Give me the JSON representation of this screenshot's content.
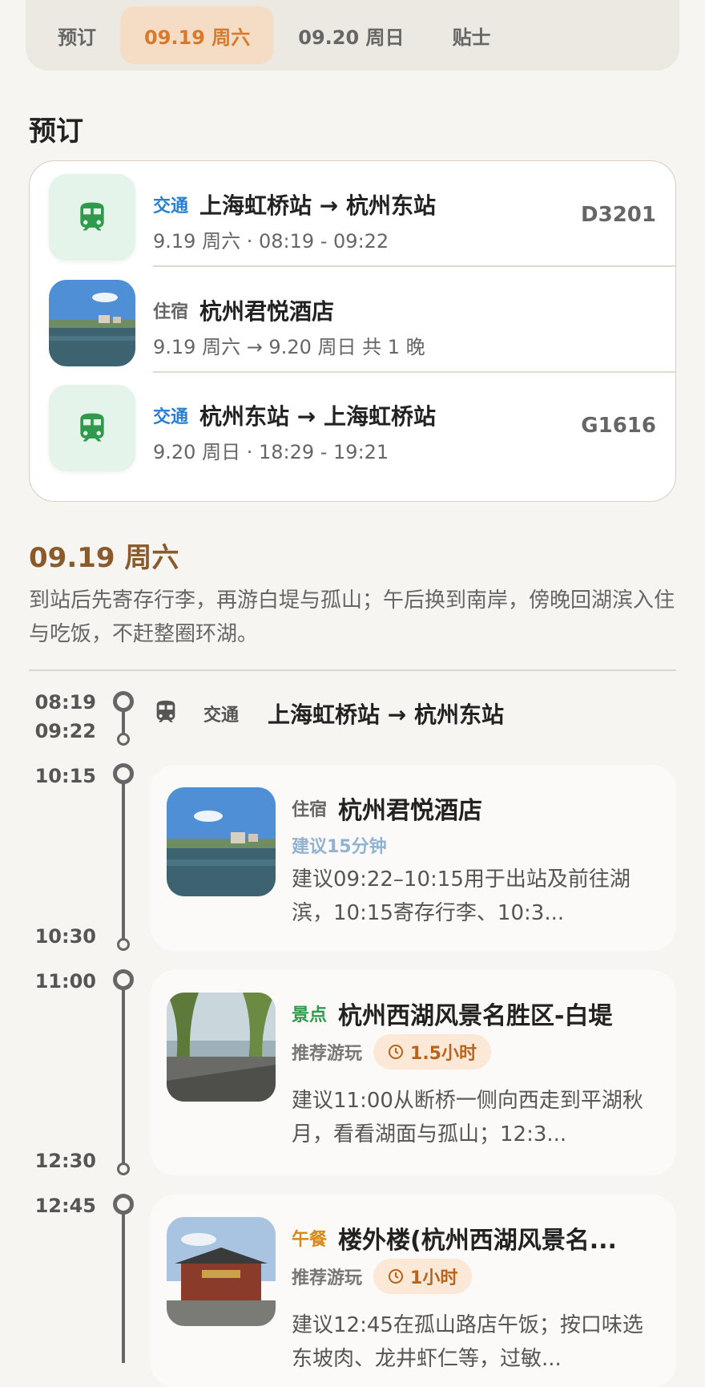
{
  "tabs": [
    "预订",
    "09.19 周六",
    "09.20 周日",
    "贴士"
  ],
  "booking_title": "预订",
  "bookings": [
    {
      "tag": "交通",
      "name": "上海虹桥站 → 杭州东站",
      "sub": "9.19 周六 · 08:19 - 09:22",
      "code": "D3201"
    },
    {
      "tag": "住宿",
      "name": "杭州君悦酒店",
      "sub": "9.19 周六 → 9.20 周日 共 1 晚"
    },
    {
      "tag": "交通",
      "name": "杭州东站 → 上海虹桥站",
      "sub": "9.20 周日 · 18:29 - 19:21",
      "code": "G1616"
    }
  ],
  "day": {
    "title": "09.19 周六",
    "desc": "到站后先寄存行李，再游白堤与孤山；午后换到南岸，傍晚回湖滨入住与吃饭，不赶整圈环湖。"
  },
  "timeline": {
    "transit": {
      "start": "08:19",
      "end": "09:22",
      "label": "交通",
      "route": "上海虹桥站 → 杭州东站"
    },
    "items": [
      {
        "start": "10:15",
        "end": "10:30",
        "tag": "住宿",
        "name": "杭州君悦酒店",
        "hint": "建议15分钟",
        "desc": "建议09:22–10:15用于出站及前往湖滨，10:15寄存行李、10:3..."
      },
      {
        "start": "11:00",
        "end": "12:30",
        "tag": "景点",
        "name": "杭州西湖风景名胜区-白堤",
        "rec_label": "推荐游玩",
        "duration": "1.5小时",
        "desc": "建议11:00从断桥一侧向西走到平湖秋月，看看湖面与孤山；12:3..."
      },
      {
        "start": "12:45",
        "tag": "午餐",
        "name": "楼外楼(杭州西湖风景名...",
        "rec_label": "推荐游玩",
        "duration": "1小时",
        "desc": "建议12:45在孤山路店午饭；按口味选东坡肉、龙井虾仁等，过敏..."
      }
    ]
  },
  "colors": {
    "accent": "#d97a2b",
    "transit_blue": "#2b7fd0",
    "train_green": "#2f9a4b",
    "day_brown": "#8a5a2b"
  }
}
